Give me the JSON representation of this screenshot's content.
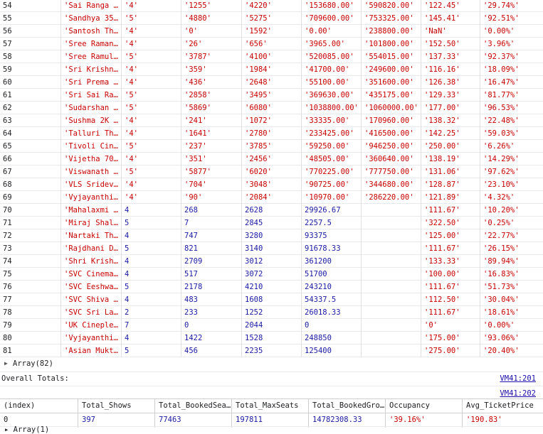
{
  "rows": [
    [
      "54",
      "'Sai Ranga ...",
      "'4'",
      "'1255'",
      "'4220'",
      "'153680.00'",
      "'590820.00'",
      "'122.45'",
      "'29.74%'"
    ],
    [
      "55",
      "'Sandhya 35...",
      "'5'",
      "'4880'",
      "'5275'",
      "'709600.00'",
      "'753325.00'",
      "'145.41'",
      "'92.51%'"
    ],
    [
      "56",
      "'Santosh Th...",
      "'4'",
      "'0'",
      "'1592'",
      "'0.00'",
      "'238800.00'",
      "'NaN'",
      "'0.00%'"
    ],
    [
      "57",
      "'Sree Raman...",
      "'4'",
      "'26'",
      "'656'",
      "'3965.00'",
      "'101800.00'",
      "'152.50'",
      "'3.96%'"
    ],
    [
      "58",
      "'Sree Ramul...",
      "'5'",
      "'3787'",
      "'4100'",
      "'520085.00'",
      "'554015.00'",
      "'137.33'",
      "'92.37%'"
    ],
    [
      "59",
      "'Sri Krishn...",
      "'4'",
      "'359'",
      "'1984'",
      "'41700.00'",
      "'249600.00'",
      "'116.16'",
      "'18.09%'"
    ],
    [
      "60",
      "'Sri Prema ...",
      "'4'",
      "'436'",
      "'2648'",
      "'55100.00'",
      "'351600.00'",
      "'126.38'",
      "'16.47%'"
    ],
    [
      "61",
      "'Sri Sai Ra...",
      "'5'",
      "'2858'",
      "'3495'",
      "'369630.00'",
      "'435175.00'",
      "'129.33'",
      "'81.77%'"
    ],
    [
      "62",
      "'Sudarshan ...",
      "'5'",
      "'5869'",
      "'6080'",
      "'1038800.00'",
      "'1060000.00'",
      "'177.00'",
      "'96.53%'"
    ],
    [
      "63",
      "'Sushma 2K ...",
      "'4'",
      "'241'",
      "'1072'",
      "'33335.00'",
      "'170960.00'",
      "'138.32'",
      "'22.48%'"
    ],
    [
      "64",
      "'Talluri Th...",
      "'4'",
      "'1641'",
      "'2780'",
      "'233425.00'",
      "'416500.00'",
      "'142.25'",
      "'59.03%'"
    ],
    [
      "65",
      "'Tivoli Cin...",
      "'5'",
      "'237'",
      "'3785'",
      "'59250.00'",
      "'946250.00'",
      "'250.00'",
      "'6.26%'"
    ],
    [
      "66",
      "'Vijetha 70...",
      "'4'",
      "'351'",
      "'2456'",
      "'48505.00'",
      "'360640.00'",
      "'138.19'",
      "'14.29%'"
    ],
    [
      "67",
      "'Viswanath ...",
      "'5'",
      "'5877'",
      "'6020'",
      "'770225.00'",
      "'777750.00'",
      "'131.06'",
      "'97.62%'"
    ],
    [
      "68",
      "'VLS Sridev...",
      "'4'",
      "'704'",
      "'3048'",
      "'90725.00'",
      "'344680.00'",
      "'128.87'",
      "'23.10%'"
    ],
    [
      "69",
      "'Vyjayanthi...",
      "'4'",
      "'90'",
      "'2084'",
      "'10970.00'",
      "'286220.00'",
      "'121.89'",
      "'4.32%'"
    ],
    [
      "70",
      "'Mahalaxmi ...",
      "4",
      "268",
      "2628",
      "29926.67",
      "",
      "'111.67'",
      "'10.20%'"
    ],
    [
      "71",
      "'Miraj Shal...",
      "5",
      "7",
      "2845",
      "2257.5",
      "",
      "'322.50'",
      "'0.25%'"
    ],
    [
      "72",
      "'Nartaki Th...",
      "4",
      "747",
      "3280",
      "93375",
      "",
      "'125.00'",
      "'22.77%'"
    ],
    [
      "73",
      "'Rajdhani D...",
      "5",
      "821",
      "3140",
      "91678.33",
      "",
      "'111.67'",
      "'26.15%'"
    ],
    [
      "74",
      "'Shri Krish...",
      "4",
      "2709",
      "3012",
      "361200",
      "",
      "'133.33'",
      "'89.94%'"
    ],
    [
      "75",
      "'SVC Cinema...",
      "4",
      "517",
      "3072",
      "51700",
      "",
      "'100.00'",
      "'16.83%'"
    ],
    [
      "76",
      "'SVC Eeshwa...",
      "5",
      "2178",
      "4210",
      "243210",
      "",
      "'111.67'",
      "'51.73%'"
    ],
    [
      "77",
      "'SVC Shiva ...",
      "4",
      "483",
      "1608",
      "54337.5",
      "",
      "'112.50'",
      "'30.04%'"
    ],
    [
      "78",
      "'SVC Sri La...",
      "2",
      "233",
      "1252",
      "26018.33",
      "",
      "'111.67'",
      "'18.61%'"
    ],
    [
      "79",
      "'UK Cineple...",
      "7",
      "0",
      "2044",
      "0",
      "",
      "'0'",
      "'0.00%'"
    ],
    [
      "80",
      "'Vyjayanthi...",
      "4",
      "1422",
      "1528",
      "248850",
      "",
      "'175.00'",
      "'93.06%'"
    ],
    [
      "81",
      "'Asian Mukt...",
      "5",
      "456",
      "2235",
      "125400",
      "",
      "'275.00'",
      "'20.40%'"
    ]
  ],
  "array_label": "Array(82)",
  "totals_label": "Overall Totals:",
  "link1": "VM41:201",
  "link2": "VM41:202",
  "totals_headers": [
    "(index)",
    "Total_Shows",
    "Total_BookedSeats",
    "Total_MaxSeats",
    "Total_BookedGross",
    "Occupancy",
    "Avg_TicketPrice"
  ],
  "totals_values": [
    "0",
    "397",
    "77463",
    "197811",
    "14782308.33",
    "'39.16%'",
    "'190.83'"
  ],
  "next_line": "▸ Array(1)"
}
